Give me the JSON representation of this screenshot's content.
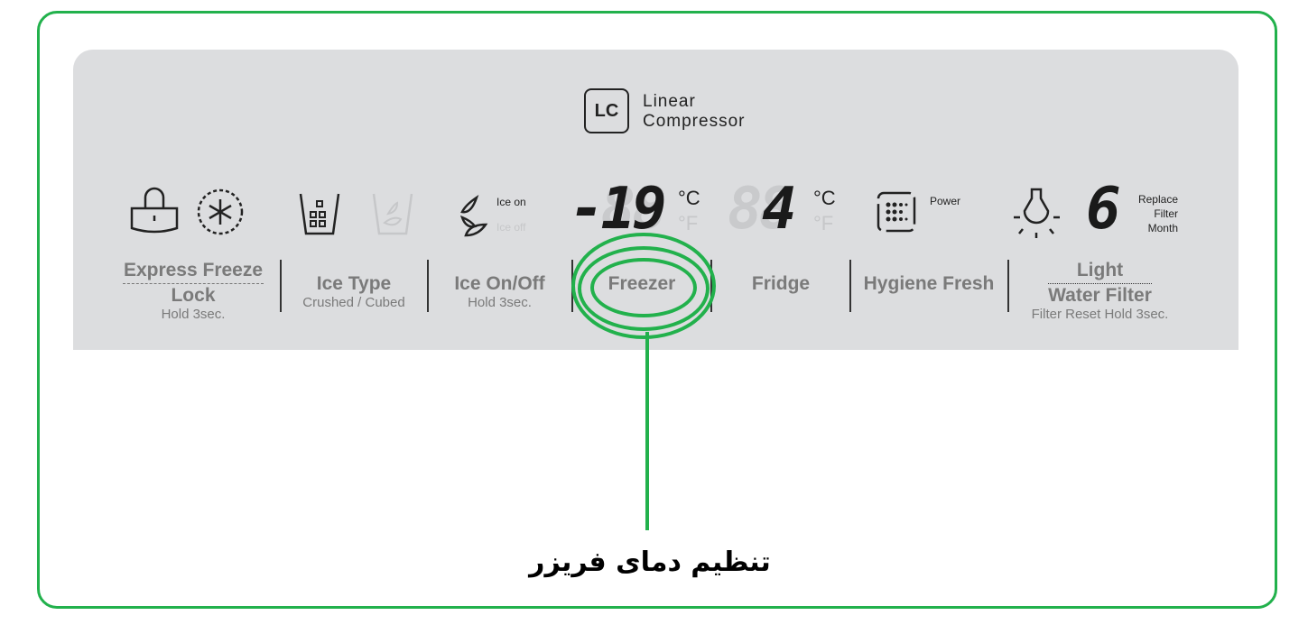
{
  "brand": {
    "line1": "Linear",
    "line2": "Compressor",
    "logo": "LC"
  },
  "indicators": {
    "ice_on": "Ice on",
    "ice_off": "Ice off",
    "freezer_temp": "-19",
    "fridge_temp": "4",
    "celsius": "°C",
    "fahrenheit": "°F",
    "power": "Power",
    "filter_month": "6",
    "replace_filter": [
      "Replace",
      "Filter",
      "Month"
    ]
  },
  "buttons": [
    {
      "top": "Express Freeze",
      "main": "Lock",
      "sub": "Hold 3sec."
    },
    {
      "main": "Ice Type",
      "sub": "Crushed / Cubed"
    },
    {
      "main": "Ice On/Off",
      "sub": "Hold 3sec."
    },
    {
      "main": "Freezer"
    },
    {
      "main": "Fridge"
    },
    {
      "main": "Hygiene Fresh"
    },
    {
      "top": "Light",
      "main": "Water Filter",
      "sub": "Filter Reset Hold 3sec."
    }
  ],
  "caption": "تنظیم دمای فریزر",
  "colors": {
    "highlight": "#22b14c",
    "panel": "#dcdddf"
  }
}
